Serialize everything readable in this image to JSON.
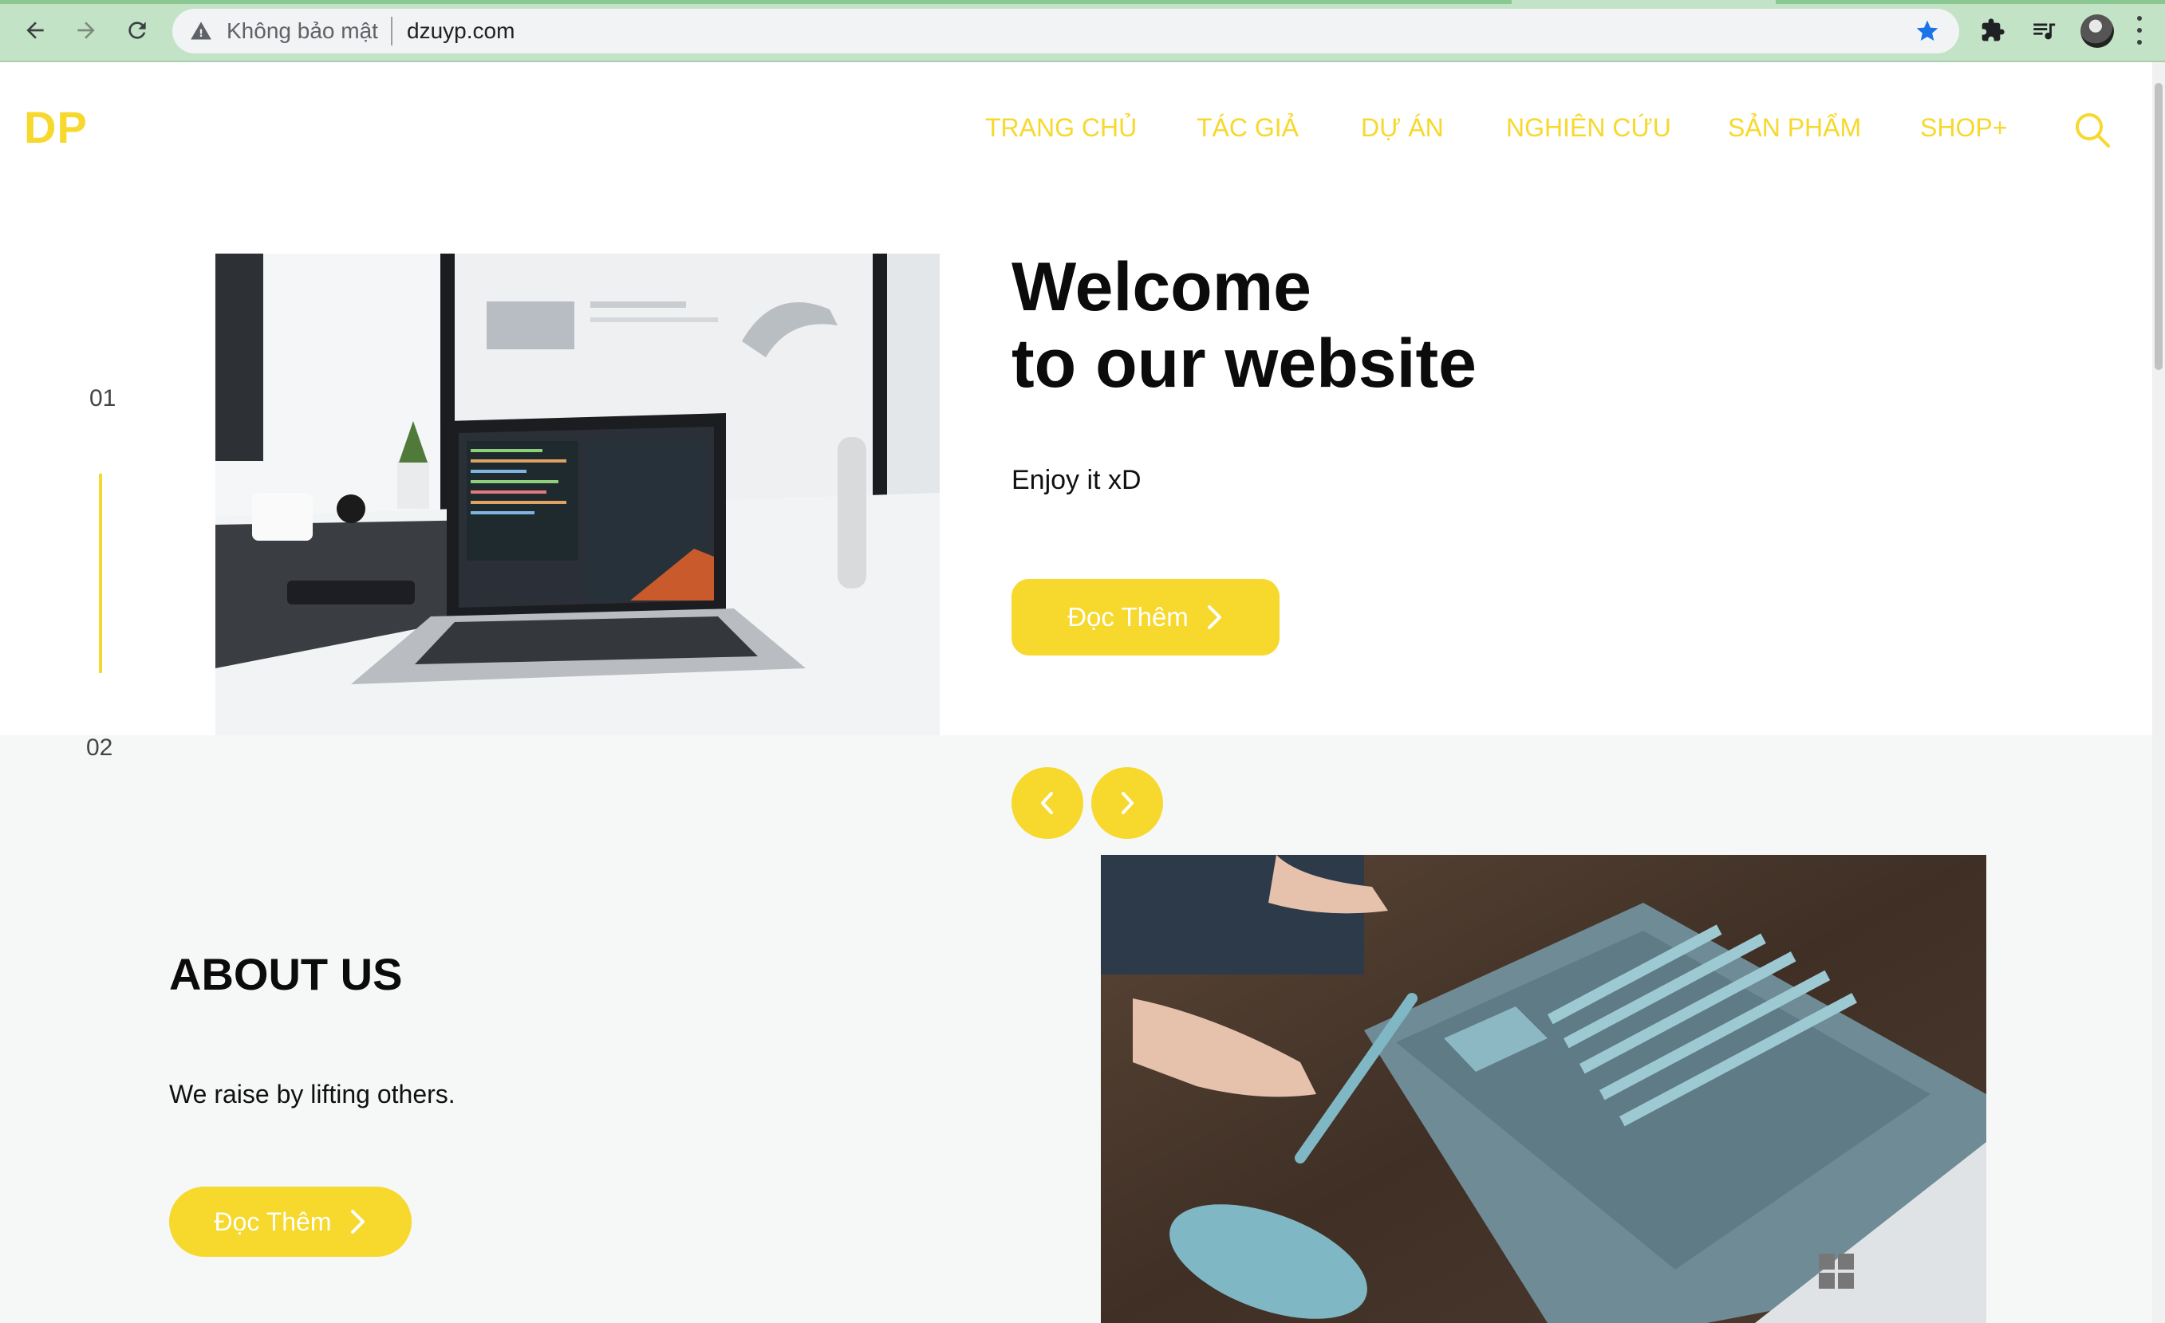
{
  "browser": {
    "security_label": "Không bảo mật",
    "url": "dzuyp.com"
  },
  "site": {
    "logo": "DP",
    "nav": [
      {
        "label": "TRANG CHỦ"
      },
      {
        "label": "TÁC GIẢ"
      },
      {
        "label": "DỰ ÁN"
      },
      {
        "label": "NGHIÊN CỨU"
      },
      {
        "label": "SẢN PHẨM"
      },
      {
        "label": "SHOP+"
      }
    ]
  },
  "hero": {
    "slide_current": "01",
    "slide_next": "02",
    "title_line1": "Welcome",
    "title_line2": "to our website",
    "subtitle": "Enjoy it xD",
    "cta_label": "Đọc Thêm"
  },
  "about": {
    "title": "ABOUT US",
    "text": "We raise by lifting others.",
    "cta_label": "Đọc Thêm"
  },
  "colors": {
    "accent": "#f7d82d",
    "chrome_frame": "#c3e3c7",
    "about_background": "#f6f8f7"
  },
  "icons": [
    "back-icon",
    "forward-icon",
    "reload-icon",
    "warning-icon",
    "bookmark-star-icon",
    "extensions-icon",
    "media-icon",
    "search-icon",
    "chevron-left-icon",
    "chevron-right-icon"
  ]
}
